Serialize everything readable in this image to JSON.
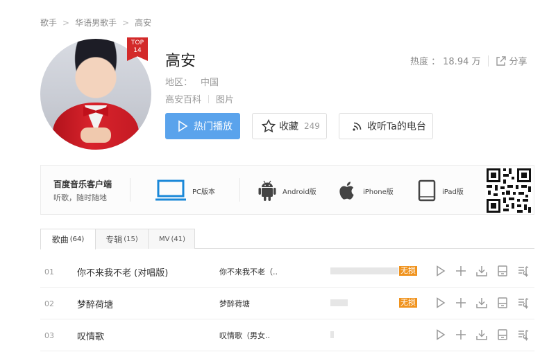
{
  "breadcrumb": [
    {
      "label": "歌手"
    },
    {
      "label": "华语男歌手"
    },
    {
      "label": "高安"
    }
  ],
  "artist": {
    "name": "高安",
    "rank_badge": {
      "top": "TOP",
      "rank": "14"
    },
    "heat_label": "热度 ：",
    "heat_value": "18.94 万",
    "share_label": "分享",
    "region_label": "地区：",
    "region_value": "中国",
    "link_baike": "高安百科",
    "link_photos": "图片"
  },
  "buttons": {
    "hot_play": "热门播放",
    "favorite": "收藏",
    "favorite_count": "249",
    "radio": "收听Ta的电台"
  },
  "client": {
    "title": "百度音乐客户端",
    "subtitle": "听歌，随时随地",
    "items": [
      {
        "label": "PC版本",
        "icon": "monitor-icon"
      },
      {
        "label": "Android版",
        "icon": "android-icon"
      },
      {
        "label": "iPhone版",
        "icon": "apple-icon"
      },
      {
        "label": "iPad版",
        "icon": "tablet-icon"
      }
    ]
  },
  "tabs": [
    {
      "label": "歌曲",
      "count": "(64)"
    },
    {
      "label": "专辑",
      "count": "(15)"
    },
    {
      "label": "MV",
      "count": "(41)"
    }
  ],
  "songs": [
    {
      "index": "01",
      "title": "你不来我不老 (对唱版)",
      "album": "你不来我不老（..",
      "popularity": 1.0,
      "lossless": "无损"
    },
    {
      "index": "02",
      "title": "梦醉荷塘",
      "album": "梦醉荷塘",
      "popularity": 0.25,
      "lossless": "无损"
    },
    {
      "index": "03",
      "title": "叹情歌",
      "album": "叹情歌（男女..",
      "popularity": 0.05,
      "lossless": ""
    }
  ],
  "colors": {
    "accent": "#5aa3ec",
    "badge": "#d32a2a",
    "lossless": "#f0931e",
    "client_icon": "#1a88d8"
  }
}
